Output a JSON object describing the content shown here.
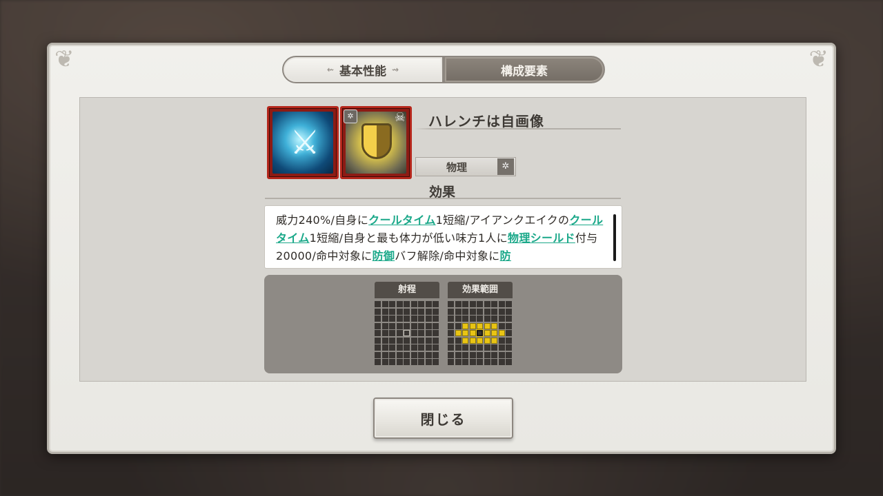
{
  "tabs": [
    {
      "label": "基本性能",
      "active": false
    },
    {
      "label": "構成要素",
      "active": true
    }
  ],
  "skill": {
    "name": "ハレンチは自画像",
    "type": "物理",
    "icons": [
      "sword-skill-icon",
      "shield-skill-icon"
    ]
  },
  "effect": {
    "title": "効果",
    "segments": [
      {
        "text": "威力240%/自身に",
        "kw": false
      },
      {
        "text": "クールタイム",
        "kw": true
      },
      {
        "text": "1短縮/アイアンクエイクの",
        "kw": false
      },
      {
        "text": "クールタイム",
        "kw": true
      },
      {
        "text": "1短縮/自身と最も体力が低い味方1人に",
        "kw": false
      },
      {
        "text": "物理シールド",
        "kw": true
      },
      {
        "text": "付与20000/命中対象に",
        "kw": false
      },
      {
        "text": "防御",
        "kw": true
      },
      {
        "text": "バフ解除/命中対象に",
        "kw": false
      },
      {
        "text": "防",
        "kw": true
      }
    ]
  },
  "range": {
    "title": "射程",
    "size": 9,
    "self": [
      4,
      4
    ],
    "hits": []
  },
  "area": {
    "title": "効果範囲",
    "size": 9,
    "center": [
      4,
      4
    ],
    "hits": [
      [
        3,
        2
      ],
      [
        3,
        3
      ],
      [
        3,
        4
      ],
      [
        3,
        5
      ],
      [
        3,
        6
      ],
      [
        4,
        1
      ],
      [
        4,
        2
      ],
      [
        4,
        3
      ],
      [
        4,
        5
      ],
      [
        4,
        6
      ],
      [
        4,
        7
      ],
      [
        5,
        2
      ],
      [
        5,
        3
      ],
      [
        5,
        4
      ],
      [
        5,
        5
      ],
      [
        5,
        6
      ]
    ]
  },
  "close_label": "閉じる",
  "colors": {
    "keyword": "#1aa889",
    "hit": "#e9c414",
    "frame": "#b5271c"
  }
}
